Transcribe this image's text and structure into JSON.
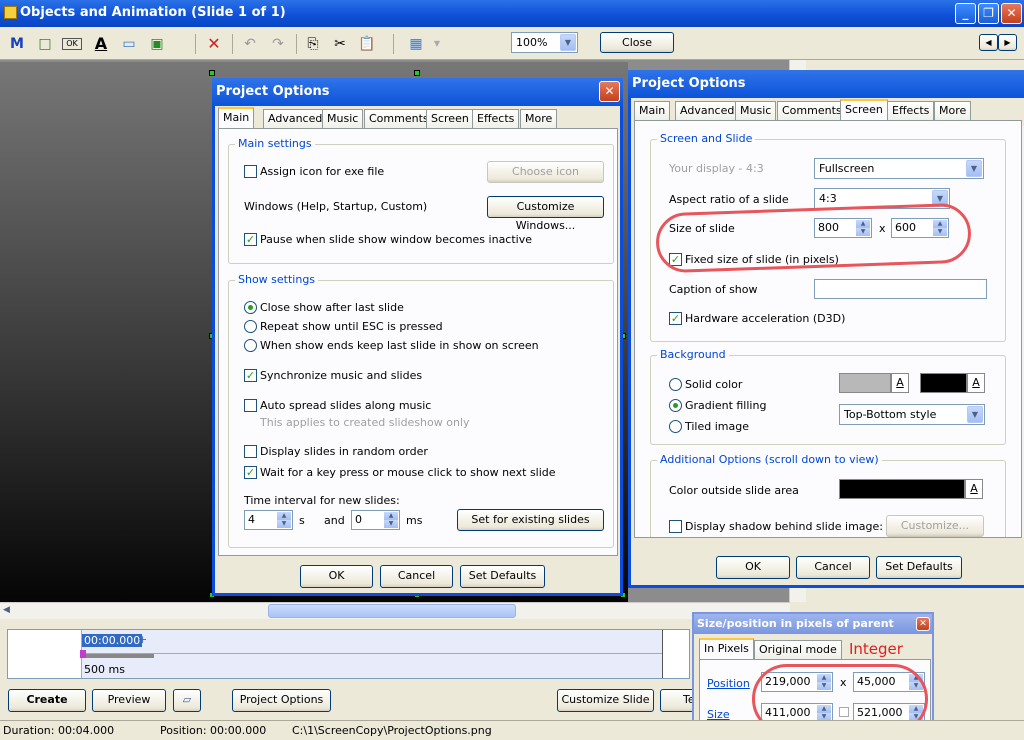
{
  "window": {
    "title": "Objects and Animation  (Slide 1 of 1)"
  },
  "toolbar": {
    "zoom": "100%",
    "close_label": "Close",
    "tools": [
      "M",
      "□",
      "OK",
      "A",
      "▭",
      "▣"
    ]
  },
  "dialog_main": {
    "title": "Project Options",
    "tabs": [
      "Main",
      "Advanced",
      "Music",
      "Comments",
      "Screen",
      "Effects",
      "More"
    ],
    "main_settings": {
      "label": "Main settings",
      "assign_icon": "Assign icon for exe file",
      "choose_icon": "Choose icon",
      "windows_label": "Windows (Help, Startup, Custom)",
      "customize_windows": "Customize Windows...",
      "pause": "Pause when slide show window becomes inactive"
    },
    "show_settings": {
      "label": "Show settings",
      "close_show": "Close show after last slide",
      "repeat_show": "Repeat show until ESC is pressed",
      "keep_last": "When show ends keep last slide in show on screen",
      "sync_music": "Synchronize music and slides",
      "auto_spread": "Auto spread slides along music",
      "auto_spread_note": "This applies to created slideshow only",
      "random_order": "Display slides in random order",
      "wait_key": "Wait for a key press or mouse click to show next slide",
      "time_interval": "Time interval for new slides:",
      "interval_value": "4",
      "interval_unit": "s",
      "and_label": "and",
      "ms_value": "0",
      "ms_unit": "ms",
      "set_existing": "Set for existing slides"
    },
    "ok": "OK",
    "cancel": "Cancel",
    "defaults": "Set Defaults"
  },
  "dialog_screen": {
    "title": "Project Options",
    "tabs": [
      "Main",
      "Advanced",
      "Music",
      "Comments",
      "Screen",
      "Effects",
      "More"
    ],
    "screen_slide": {
      "label": "Screen and Slide",
      "your_display": "Your display - 4:3",
      "display_value": "Fullscreen",
      "aspect_label": "Aspect ratio of a slide",
      "aspect_value": "4:3",
      "size_label": "Size of slide",
      "width": "800",
      "x": "x",
      "height": "600",
      "fixed_size": "Fixed size of slide (in pixels)",
      "caption": "Caption of show",
      "hw_accel": "Hardware acceleration (D3D)"
    },
    "background": {
      "label": "Background",
      "solid": "Solid color",
      "gradient": "Gradient filling",
      "tiled": "Tiled image",
      "style": "Top-Bottom style",
      "a": "A"
    },
    "additional": {
      "label": "Additional Options (scroll down to view)",
      "outside_color": "Color outside slide area",
      "shadow": "Display shadow behind slide image:",
      "customize": "Customize..."
    },
    "ok": "OK",
    "cancel": "Cancel",
    "defaults": "Set Defaults"
  },
  "size_panel": {
    "title": "Size/position in pixels of parent",
    "tabs": [
      "In Pixels",
      "Original mode"
    ],
    "annotation": "Integer values",
    "position_label": "Position",
    "pos_x": "219,000",
    "pos_y": "45,000",
    "size_label": "Size",
    "size_w": "411,000",
    "size_h": "521,000",
    "x": "x"
  },
  "timeline": {
    "time": "00:00.000",
    "plus": "+",
    "marker": "500 ms"
  },
  "buttons": {
    "create": "Create",
    "preview": "Preview",
    "project_options": "Project Options",
    "customize_slide": "Customize Slide",
    "te": "Te"
  },
  "status": {
    "duration": "Duration:  00:04.000",
    "position": "Position:  00:00.000",
    "path": "C:\\1\\ScreenCopy\\ProjectOptions.png"
  }
}
